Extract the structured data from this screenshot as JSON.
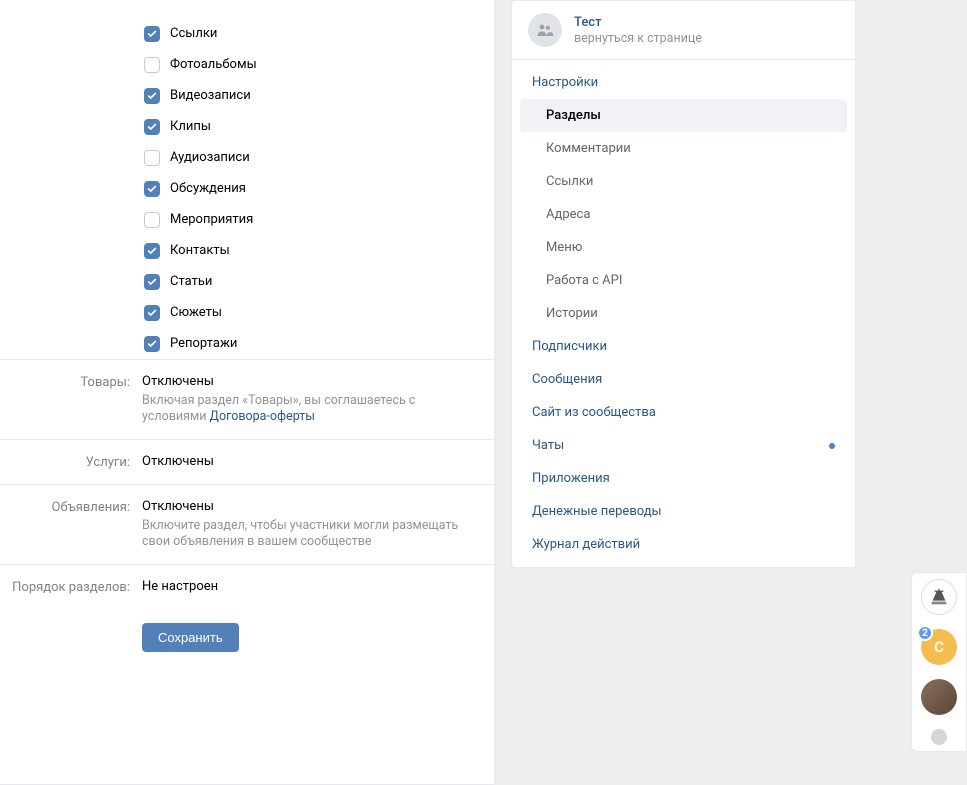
{
  "checkboxes": [
    {
      "label": "Ссылки",
      "checked": true
    },
    {
      "label": "Фотоальбомы",
      "checked": false
    },
    {
      "label": "Видеозаписи",
      "checked": true
    },
    {
      "label": "Клипы",
      "checked": true
    },
    {
      "label": "Аудиозаписи",
      "checked": false
    },
    {
      "label": "Обсуждения",
      "checked": true
    },
    {
      "label": "Мероприятия",
      "checked": false
    },
    {
      "label": "Контакты",
      "checked": true
    },
    {
      "label": "Статьи",
      "checked": true
    },
    {
      "label": "Сюжеты",
      "checked": true
    },
    {
      "label": "Репортажи",
      "checked": true
    }
  ],
  "goods": {
    "label": "Товары:",
    "value": "Отключены",
    "hint_pre": "Включая раздел «Товары», вы соглашаетесь с условиями ",
    "hint_link": "Договора-оферты"
  },
  "services": {
    "label": "Услуги:",
    "value": "Отключены"
  },
  "ads": {
    "label": "Объявления:",
    "value": "Отключены",
    "hint": "Включите раздел, чтобы участники могли размещать свои объявления в вашем сообществе"
  },
  "order": {
    "label": "Порядок разделов:",
    "value": "Не настроен"
  },
  "save_button": "Сохранить",
  "group": {
    "name": "Тест",
    "return": "вернуться к странице"
  },
  "nav": {
    "settings": "Настройки",
    "sections": "Разделы",
    "comments": "Комментарии",
    "links": "Ссылки",
    "addresses": "Адреса",
    "menu": "Меню",
    "api": "Работа с API",
    "stories": "Истории",
    "subscribers": "Подписчики",
    "messages": "Сообщения",
    "site": "Сайт из сообщества",
    "chats": "Чаты",
    "apps": "Приложения",
    "transfers": "Денежные переводы",
    "log": "Журнал действий"
  },
  "float": {
    "badge": "2",
    "letter": "С"
  }
}
